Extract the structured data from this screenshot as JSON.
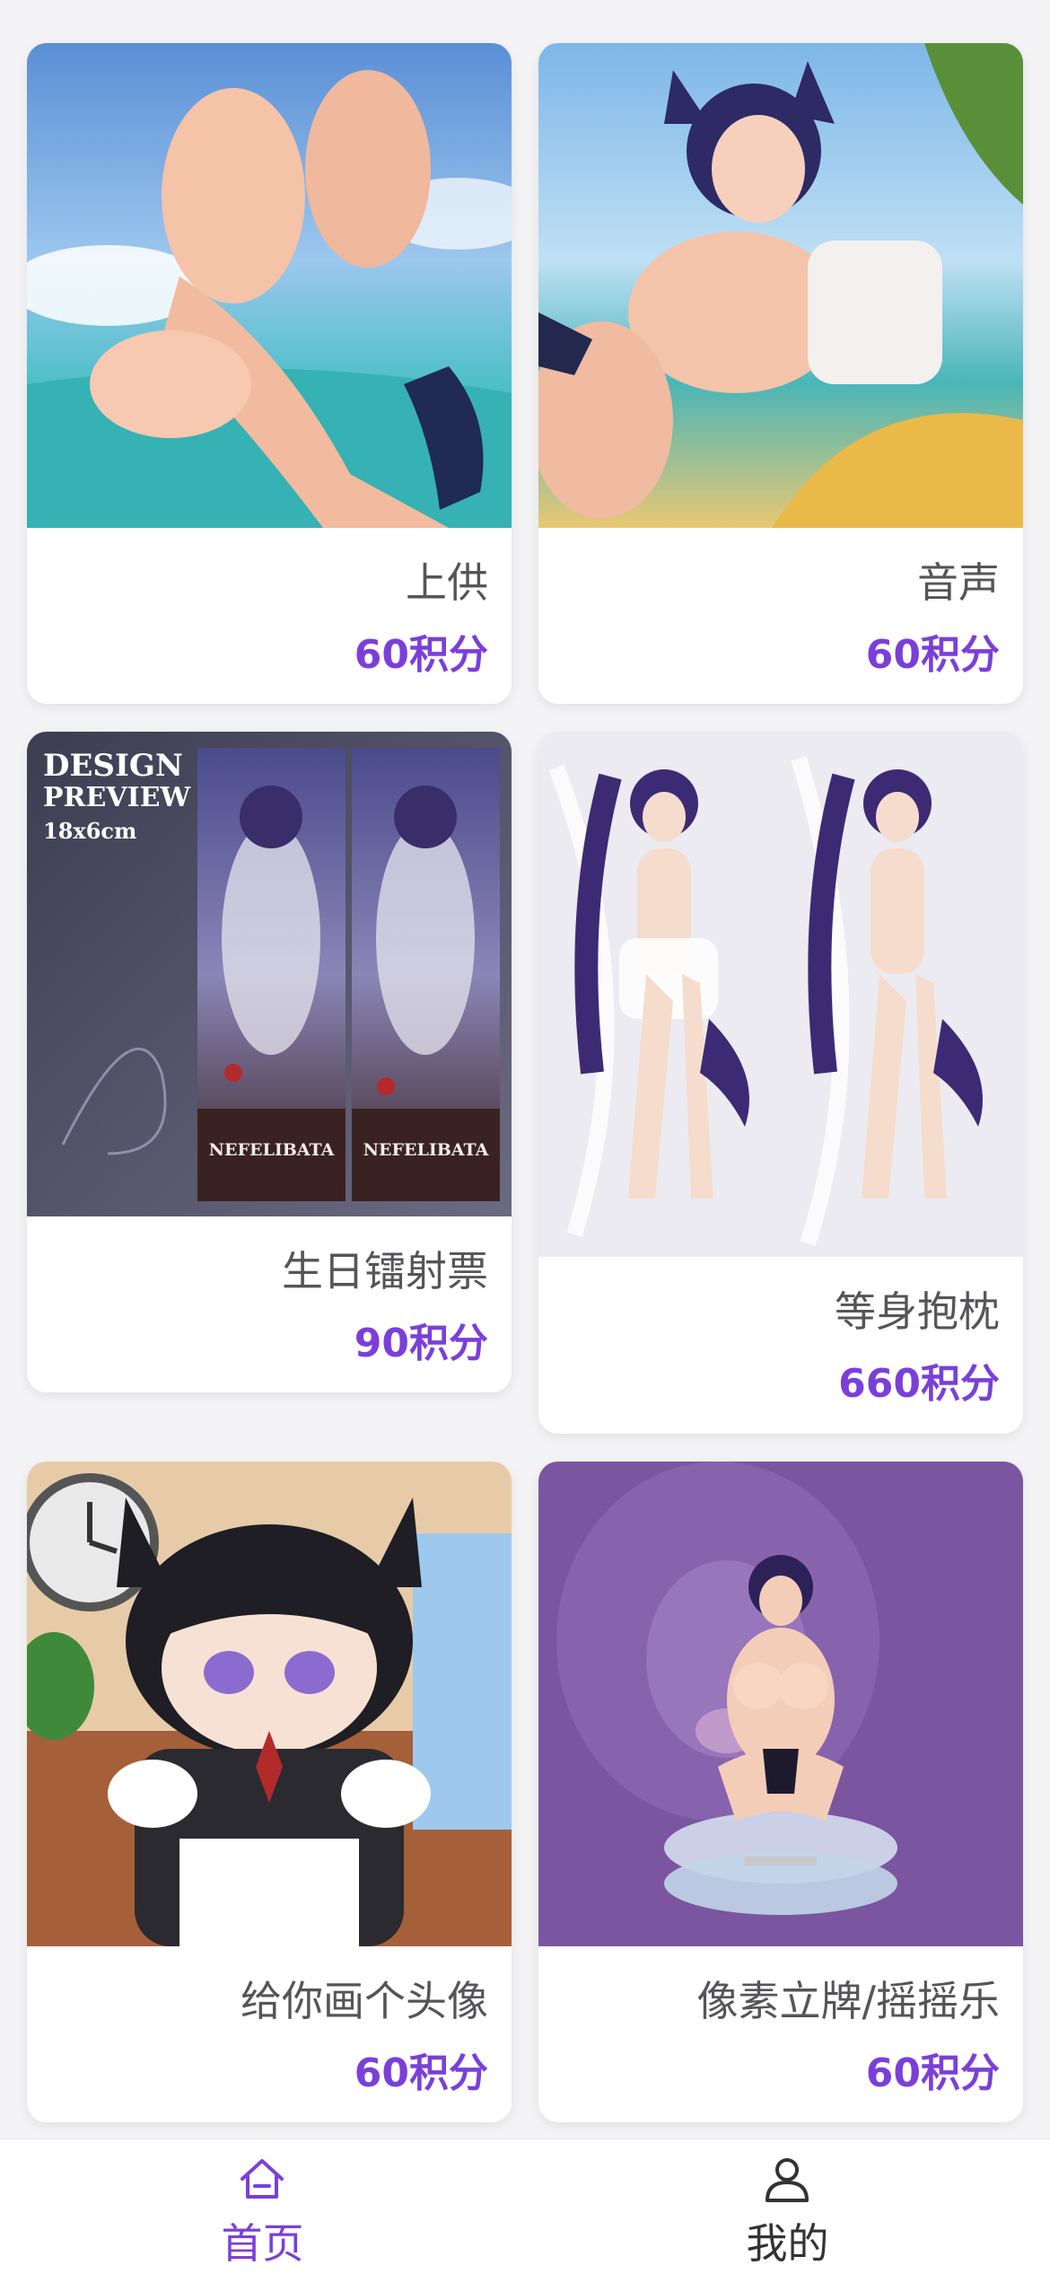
{
  "products": [
    {
      "name": "上供",
      "price": "60积分"
    },
    {
      "name": "音声",
      "price": "60积分"
    },
    {
      "name": "生日镭射票",
      "price": "90积分"
    },
    {
      "name": "等身抱枕",
      "price": "660积分"
    },
    {
      "name": "给你画个头像",
      "price": "60积分"
    },
    {
      "name": "像素立牌/摇摇乐",
      "price": "60积分"
    }
  ],
  "preview_text": {
    "line1": "DESIGN",
    "line2": "PREVIEW",
    "size": "18x6cm",
    "brand1": "NEFELIBATA",
    "brand2": "NEFELIBATA"
  },
  "tabbar": {
    "home_label": "首页",
    "home_icon": "home-icon",
    "mine_label": "我的",
    "mine_icon": "user-icon",
    "active_color": "#7b3fd9",
    "inactive_color": "#333333"
  },
  "colors": {
    "price": "#7b3fd9",
    "name": "#555558",
    "background": "#f4f4f6"
  }
}
